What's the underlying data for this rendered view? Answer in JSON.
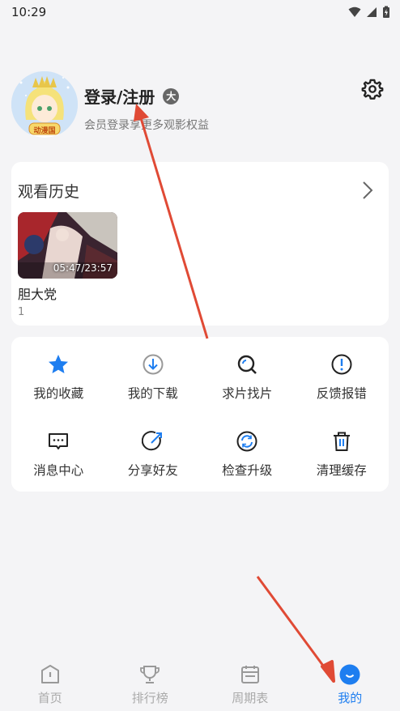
{
  "status_bar": {
    "time": "10:29"
  },
  "profile": {
    "name": "登录/注册",
    "badge": "大",
    "subtitle": "会员登录享更多观影权益",
    "avatar_text": "动漫国"
  },
  "history": {
    "title": "观看历史",
    "items": [
      {
        "title": "胆大党",
        "episode": "1",
        "progress": "05:47/23:57"
      }
    ]
  },
  "menu": {
    "items": [
      {
        "label": "我的收藏",
        "icon": "star-icon"
      },
      {
        "label": "我的下载",
        "icon": "download-icon"
      },
      {
        "label": "求片找片",
        "icon": "search-icon"
      },
      {
        "label": "反馈报错",
        "icon": "alert-icon"
      },
      {
        "label": "消息中心",
        "icon": "message-icon"
      },
      {
        "label": "分享好友",
        "icon": "share-icon"
      },
      {
        "label": "检查升级",
        "icon": "refresh-icon"
      },
      {
        "label": "清理缓存",
        "icon": "trash-icon"
      }
    ]
  },
  "tabbar": {
    "tabs": [
      {
        "label": "首页",
        "icon": "home-icon"
      },
      {
        "label": "排行榜",
        "icon": "trophy-icon"
      },
      {
        "label": "周期表",
        "icon": "calendar-icon"
      },
      {
        "label": "我的",
        "icon": "profile-icon"
      }
    ],
    "active_index": 3
  },
  "colors": {
    "accent": "#1e7ef0",
    "annotation_arrow": "#e04a35",
    "background": "#f4f4f6"
  }
}
